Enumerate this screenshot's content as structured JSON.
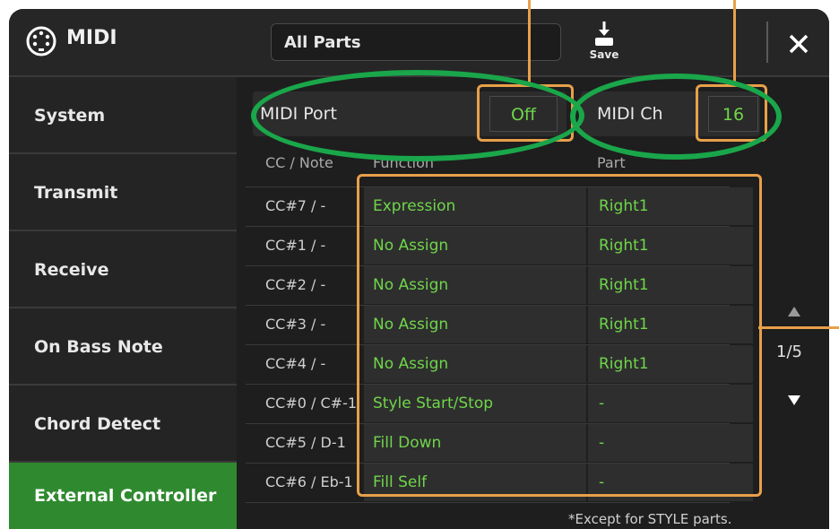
{
  "header": {
    "title": "MIDI",
    "parts_field": "All Parts",
    "save_label": "Save",
    "icons": [
      "midi-connector-icon",
      "save-download-icon",
      "close-icon"
    ]
  },
  "sidebar": {
    "items": [
      {
        "label": "System"
      },
      {
        "label": "Transmit"
      },
      {
        "label": "Receive"
      },
      {
        "label": "On Bass Note"
      },
      {
        "label": "Chord Detect"
      },
      {
        "label": "External Controller",
        "active": true
      }
    ]
  },
  "settings": {
    "port_label": "MIDI Port",
    "port_value": "Off",
    "channel_label": "MIDI Ch",
    "channel_value": "16"
  },
  "table": {
    "headers": [
      "CC / Note",
      "Function",
      "Part"
    ],
    "rows": [
      {
        "cc": "CC#7 / -",
        "function": "Expression",
        "part": "Right1"
      },
      {
        "cc": "CC#1 / -",
        "function": "No Assign",
        "part": "Right1"
      },
      {
        "cc": "CC#2 / -",
        "function": "No Assign",
        "part": "Right1"
      },
      {
        "cc": "CC#3 / -",
        "function": "No Assign",
        "part": "Right1"
      },
      {
        "cc": "CC#4 / -",
        "function": "No Assign",
        "part": "Right1"
      },
      {
        "cc": "CC#0 / C#-1",
        "function": "Style Start/Stop",
        "part": "-"
      },
      {
        "cc": "CC#5 / D-1",
        "function": "Fill Down",
        "part": "-"
      },
      {
        "cc": "CC#6 / Eb-1",
        "function": "Fill Self",
        "part": "-"
      }
    ]
  },
  "pagination": {
    "page_indicator": "1/5"
  },
  "footnote": "*Except for STYLE parts.",
  "colors": {
    "value_green": "#6fd64a",
    "active_green": "#2f8a2f",
    "highlight_orange": "#e8a04a",
    "oval_green": "#1aa64a"
  }
}
